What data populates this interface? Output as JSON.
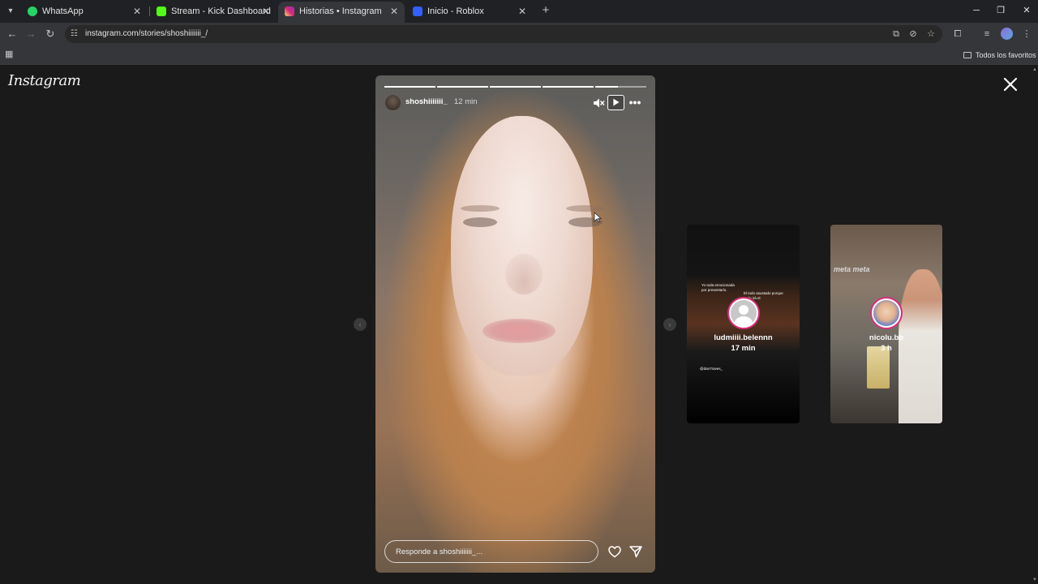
{
  "browser": {
    "tabs": [
      {
        "label": "WhatsApp",
        "favicon_color": "#25d366",
        "active": false
      },
      {
        "label": "Stream - Kick Dashboard",
        "favicon_color": "#53fc18",
        "active": false
      },
      {
        "label": "Historias • Instagram",
        "favicon_color": "#e1306c",
        "active": true
      },
      {
        "label": "Inicio - Roblox",
        "favicon_color": "#335fff",
        "active": false
      }
    ],
    "url": "instagram.com/stories/shoshiiiiiii_/",
    "bookmarks_folder": "Todos los favoritos"
  },
  "page": {
    "logo": "Instagram",
    "story": {
      "username": "shoshiiiiiii_",
      "time": "12 min",
      "segment_progress": [
        1,
        1,
        1,
        1,
        0.45
      ],
      "reply_placeholder": "Responde a shoshiiiiiii_..."
    },
    "upcoming": [
      {
        "username": "ludmiiii.belennn",
        "time": "17 min",
        "overlay_texts": [
          "Yo toda emocionada por presentarlo.",
          "El todo asustado porque se lo irá el",
          "@dan7raves_"
        ]
      },
      {
        "username": "nicolu.bb",
        "time": "3 h",
        "overlay_texts": [
          "meta meta"
        ]
      }
    ]
  },
  "colors": {
    "ring": "#d82e7a",
    "page_bg": "#1a1a1a"
  }
}
